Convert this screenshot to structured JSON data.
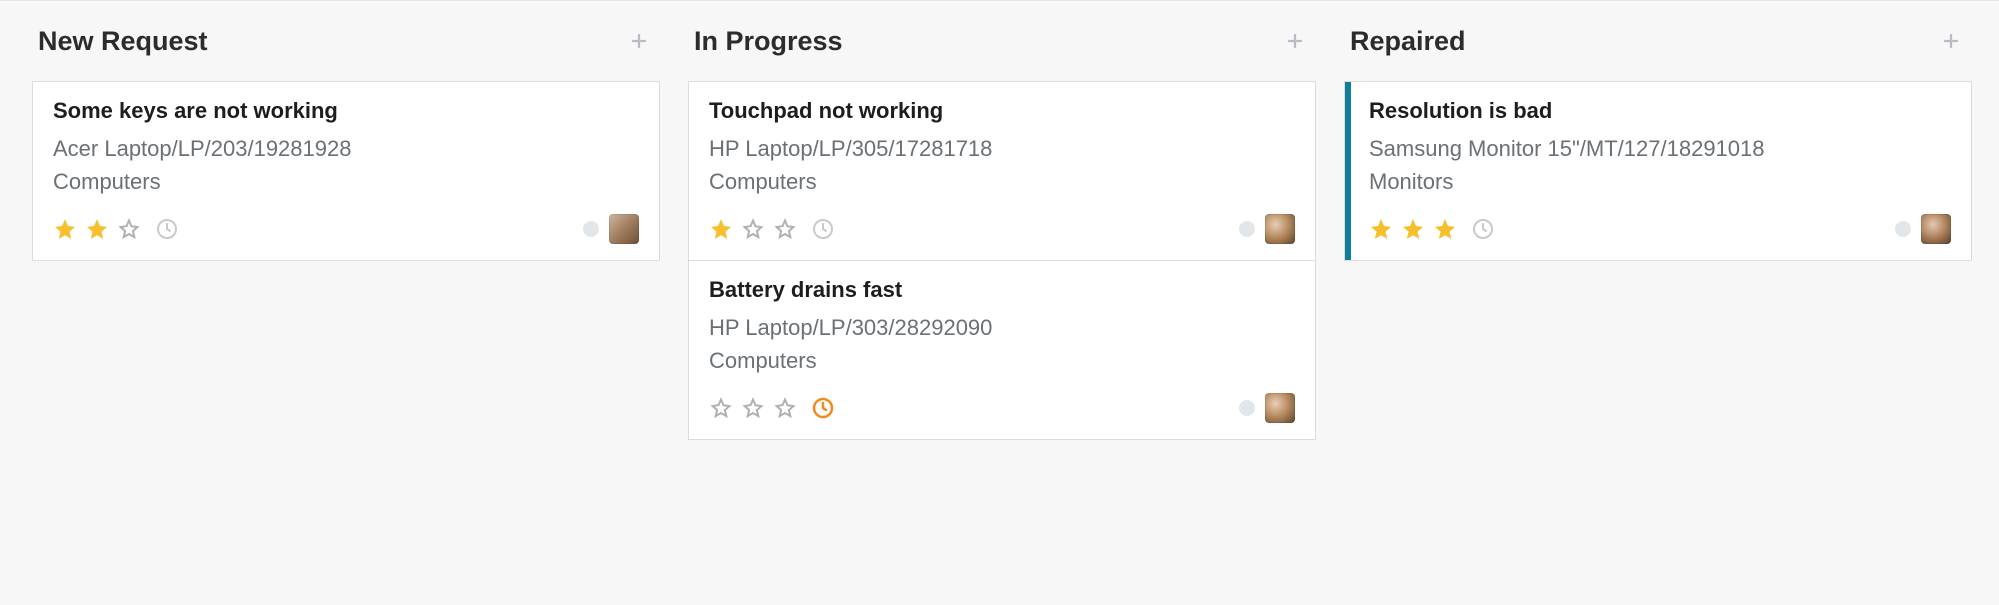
{
  "columns": [
    {
      "title": "New Request",
      "cards": [
        {
          "title": "Some keys are not working",
          "asset": "Acer Laptop/LP/203/19281928",
          "category": "Computers",
          "rating": 2,
          "max_rating": 3,
          "clock_active": false,
          "has_stripe": false,
          "avatar_variant": "av1"
        }
      ]
    },
    {
      "title": "In Progress",
      "cards": [
        {
          "title": "Touchpad not working",
          "asset": "HP Laptop/LP/305/17281718",
          "category": "Computers",
          "rating": 1,
          "max_rating": 3,
          "clock_active": false,
          "has_stripe": false,
          "avatar_variant": "av2"
        },
        {
          "title": "Battery drains fast",
          "asset": "HP Laptop/LP/303/28292090",
          "category": "Computers",
          "rating": 0,
          "max_rating": 3,
          "clock_active": true,
          "has_stripe": false,
          "avatar_variant": "av2"
        }
      ]
    },
    {
      "title": "Repaired",
      "cards": [
        {
          "title": "Resolution is bad",
          "asset": "Samsung Monitor 15\"/MT/127/18291018",
          "category": "Monitors",
          "rating": 3,
          "max_rating": 3,
          "clock_active": false,
          "has_stripe": true,
          "stripe_color": "#0f7e9b",
          "avatar_variant": "av3"
        }
      ]
    }
  ],
  "colors": {
    "star_filled": "#f6c02d",
    "star_empty": "#b0b0b0",
    "clock_active": "#f08a1d",
    "clock_inactive": "#c9c9c9"
  }
}
